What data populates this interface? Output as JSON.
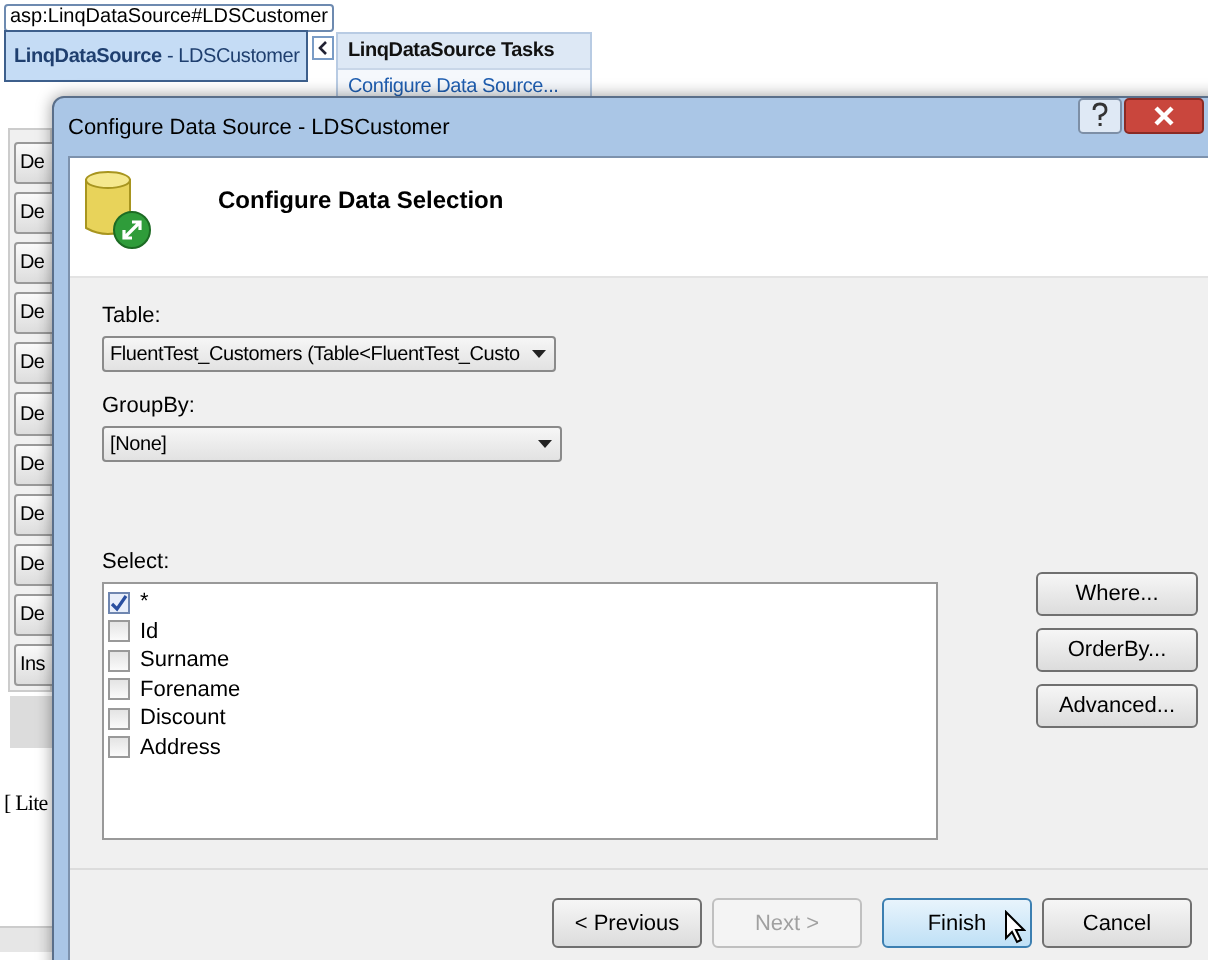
{
  "designer": {
    "tag": "asp:LinqDataSource#LDSCustomer",
    "control": "**LinqDataSource** - LDSCustomer",
    "tasks": {
      "title": "LinqDataSource Tasks",
      "link": "Configure Data Source..."
    },
    "grid_buttons": [
      "De",
      "De",
      "De",
      "De",
      "De",
      "De",
      "De",
      "De",
      "De",
      "De",
      "Ins"
    ],
    "literal": "[ Lite"
  },
  "dialog": {
    "title": "Configure Data Source - LDSCustomer",
    "heading": "Configure Data Selection",
    "table": {
      "label": "Table:",
      "value": "FluentTest_Customers (Table<FluentTest_Custo"
    },
    "groupby": {
      "label": "GroupBy:",
      "value": "[None]"
    },
    "select": {
      "label": "Select:",
      "fields": [
        {
          "label": "*",
          "checked": true
        },
        {
          "label": "Id",
          "checked": false
        },
        {
          "label": "Surname",
          "checked": false
        },
        {
          "label": "Forename",
          "checked": false
        },
        {
          "label": "Discount",
          "checked": false
        },
        {
          "label": "Address",
          "checked": false
        }
      ]
    },
    "side_buttons": [
      "Where...",
      "OrderBy...",
      "Advanced..."
    ],
    "footer_buttons": [
      {
        "label": "< Previous",
        "disabled": false,
        "hovered": false
      },
      {
        "label": "Next >",
        "disabled": true,
        "hovered": false
      },
      {
        "label": "Finish",
        "disabled": false,
        "hovered": true
      },
      {
        "label": "Cancel",
        "disabled": false,
        "hovered": false
      }
    ]
  }
}
